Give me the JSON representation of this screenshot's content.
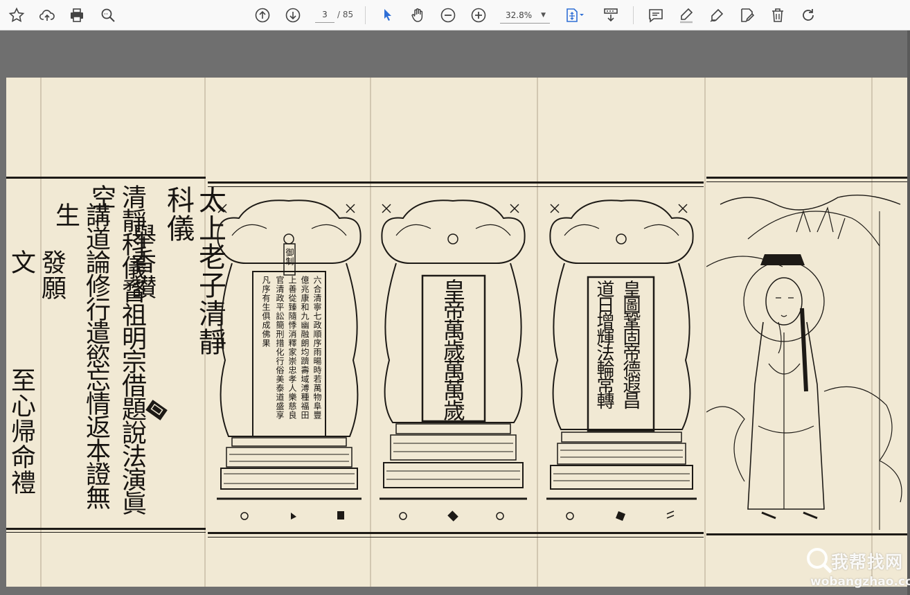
{
  "toolbar": {
    "page_current": "3",
    "page_total": "/ 85",
    "zoom": "32.8%",
    "accent": "#2f6fd6"
  },
  "document": {
    "right_col_title": "太上老子清靜科儀",
    "col_hymn": "舉香讃",
    "col_text_1": "清靜科儀瞀祖明宗借題說法演眞空",
    "col_text_2": "講道論修行遣慾忘情返本證無生",
    "col_vow": "發願文",
    "col_salute": "至心帰命禮",
    "tablet_left_header": "御制",
    "tablet_left_col_1": "六合清寧七政順序雨暘時若萬物阜豐",
    "tablet_left_col_2": "億兆康和九幽融朗均躋壽域溥種福田",
    "tablet_left_col_3": "上善從臻隨悸消釋家崇忠孝人樂慈良",
    "tablet_left_col_4": "官清政平訟簡刑措化行俗美泰道盛享",
    "tablet_left_col_5": "凡序有生俱成佛果",
    "tablet_middle_col_1": "皇帝萬歲萬萬歲",
    "tablet_right_col_1": "皇圖鞏固帝德遐昌",
    "tablet_right_col_2": "道日增輝法輪常轉"
  },
  "watermark": {
    "cn": "我帮找网",
    "en": "wobangzhao.com"
  }
}
